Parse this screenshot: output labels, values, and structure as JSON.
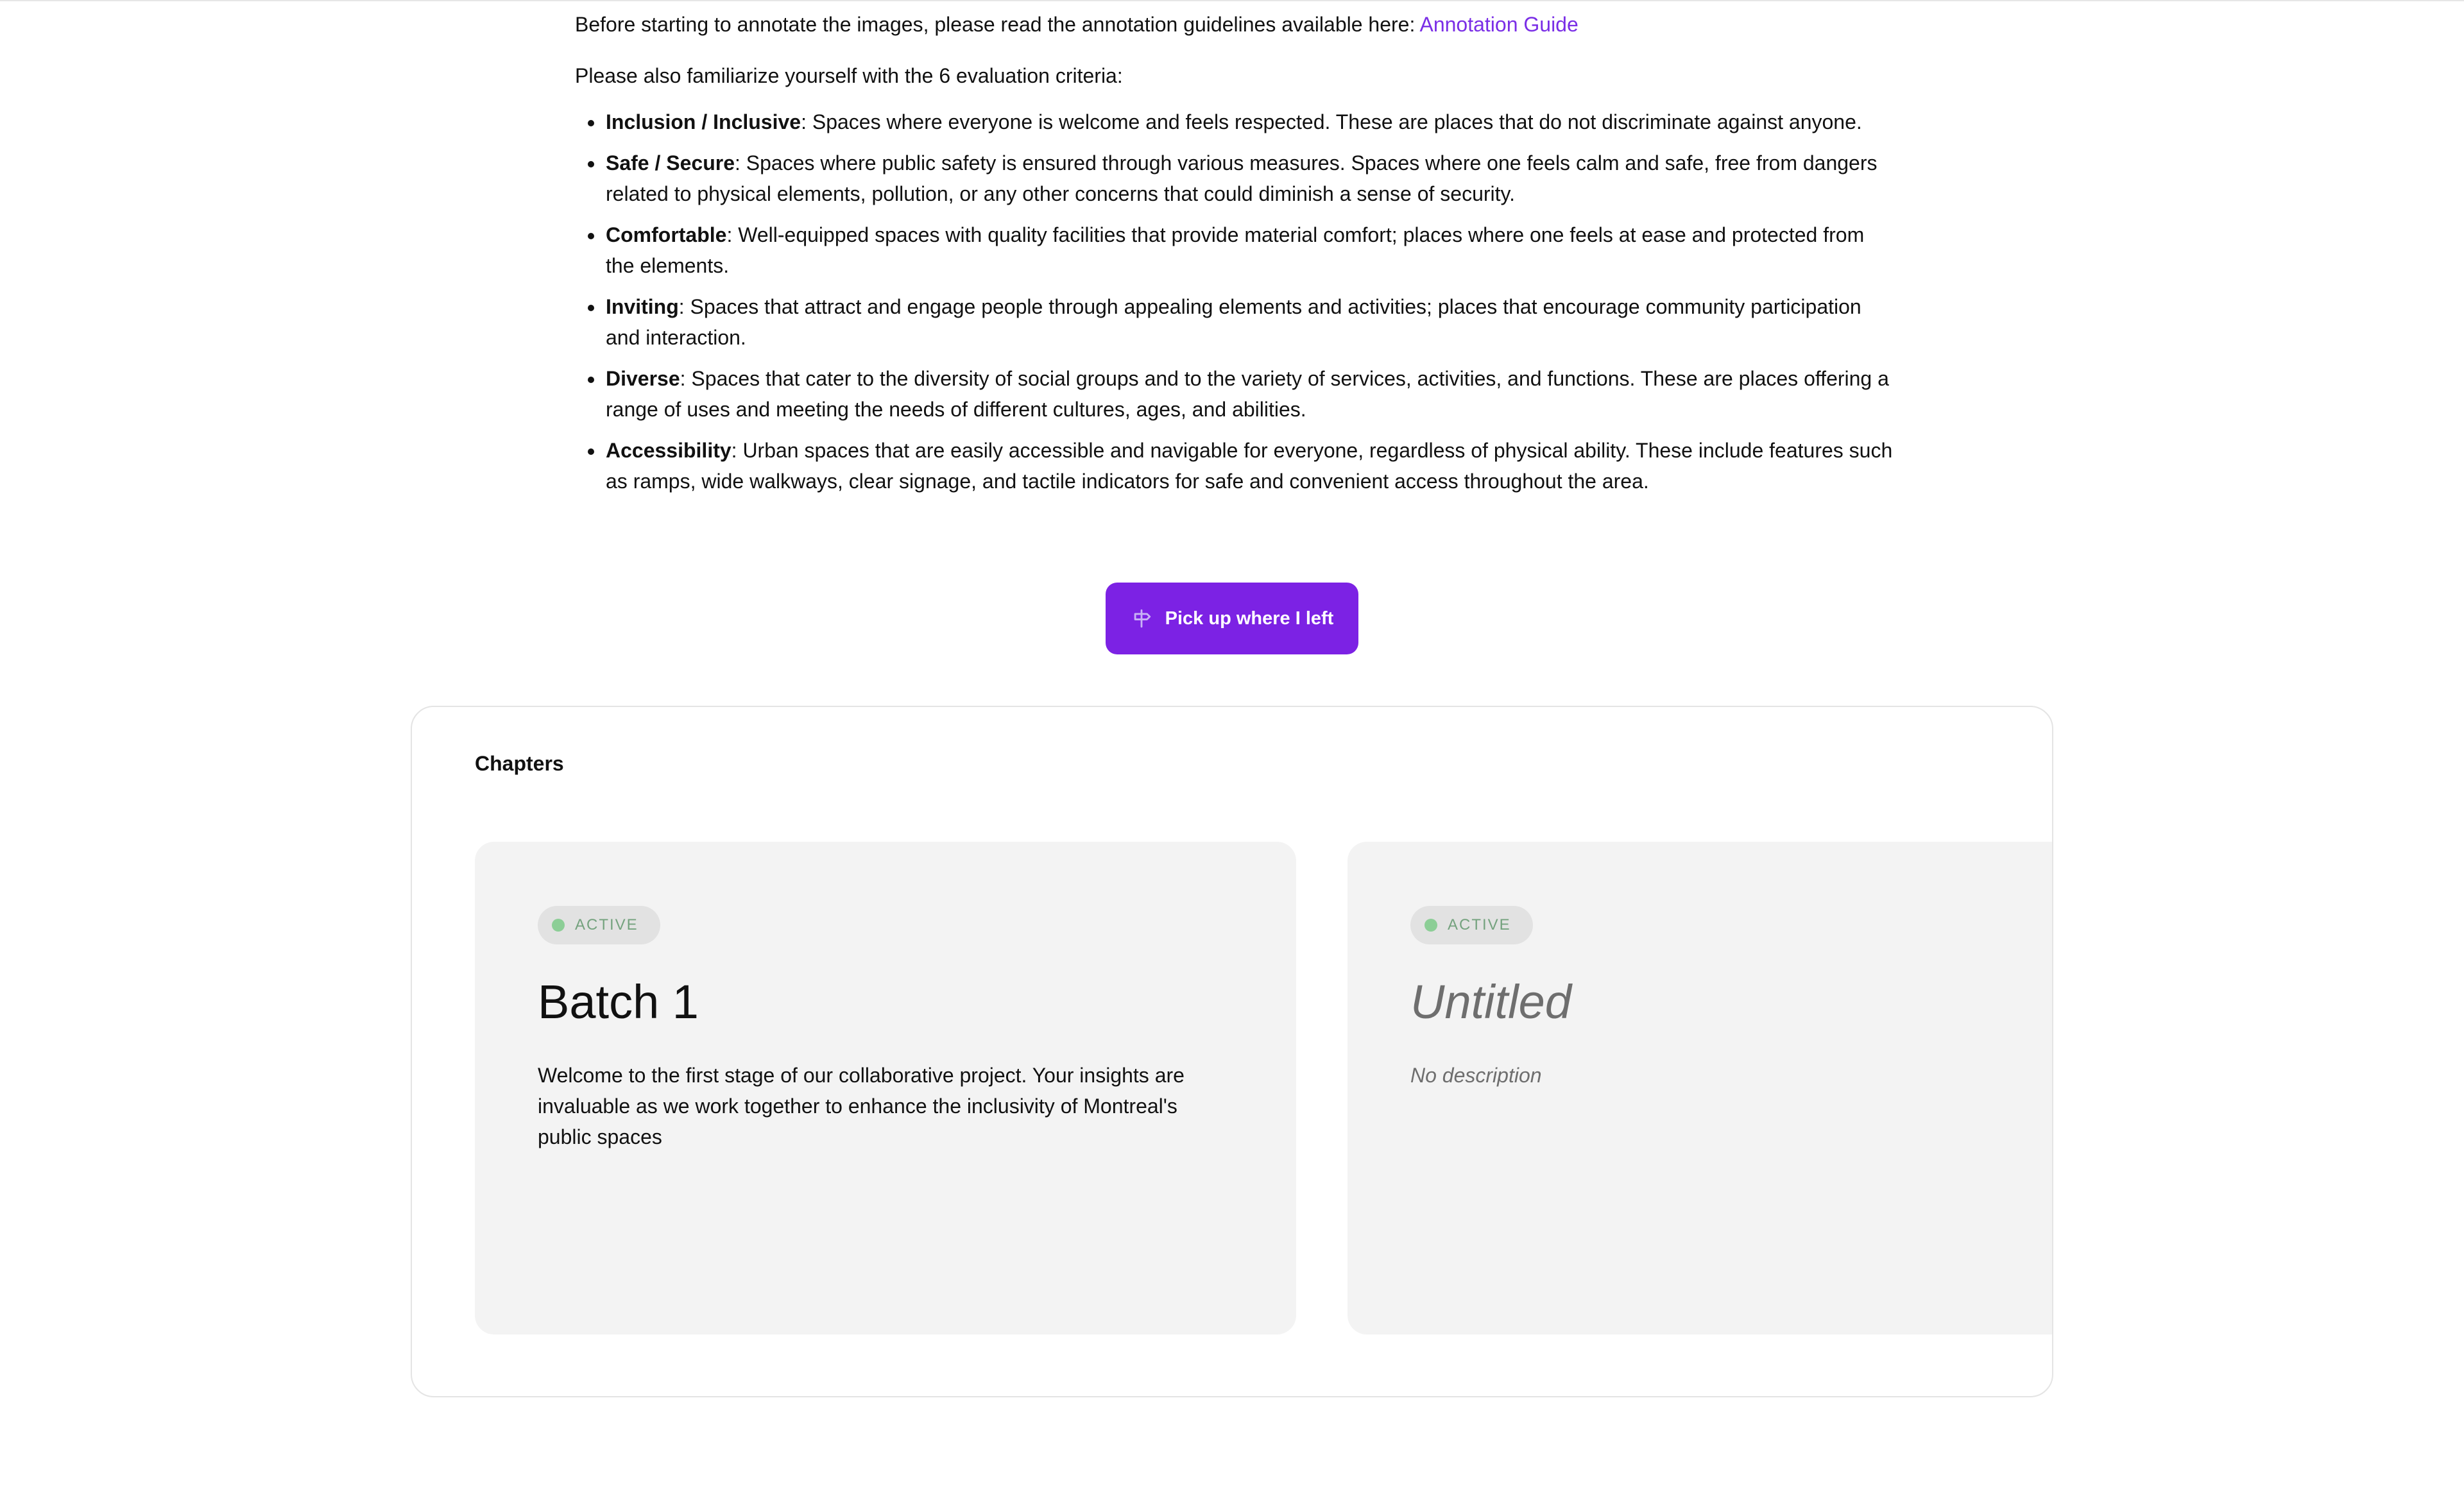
{
  "intro": {
    "guide_text": "Before starting to annotate the images, please read the annotation guidelines available here: ",
    "guide_link": "Annotation Guide",
    "criteria_intro": "Please also familiarize yourself with the 6 evaluation criteria:",
    "criteria": [
      {
        "term": "Inclusion / Inclusive",
        "text": ": Spaces where everyone is welcome and feels respected. These are places that do not discriminate against anyone."
      },
      {
        "term": "Safe / Secure",
        "text": ": Spaces where public safety is ensured through various measures. Spaces where one feels calm and safe, free from dangers related to physical elements, pollution, or any other concerns that could diminish a sense of security."
      },
      {
        "term": "Comfortable",
        "text": ": Well-equipped spaces with quality facilities that provide material comfort; places where one feels at ease and protected from the elements."
      },
      {
        "term": "Inviting",
        "text": ": Spaces that attract and engage people through appealing elements and activities; places that encourage community participation and interaction."
      },
      {
        "term": "Diverse",
        "text": ": Spaces that cater to the diversity of social groups and to the variety of services, activities, and functions. These are places offering a range of uses and meeting the needs of different cultures, ages, and abilities."
      },
      {
        "term": "Accessibility",
        "text": ": Urban spaces that are easily accessible and navigable for everyone, regardless of physical ability. These include features such as ramps, wide walkways, clear signage, and tactile indicators for safe and convenient access throughout the area."
      }
    ]
  },
  "pickup_button": {
    "label": "Pick up where I left",
    "icon": "signpost-icon"
  },
  "chapters": {
    "title": "Chapters",
    "cards": [
      {
        "status": "ACTIVE",
        "title": "Batch 1",
        "description": "Welcome to the first stage of our collaborative project. Your insights are invaluable as we work together to enhance the inclusivity of Montreal's public spaces"
      },
      {
        "status": "ACTIVE",
        "title": "Untitled",
        "description": "No description"
      }
    ]
  },
  "colors": {
    "accent": "#7c22e4",
    "link": "#7a2ee6",
    "status_green": "#8cce96",
    "card_bg": "#f3f3f3"
  }
}
